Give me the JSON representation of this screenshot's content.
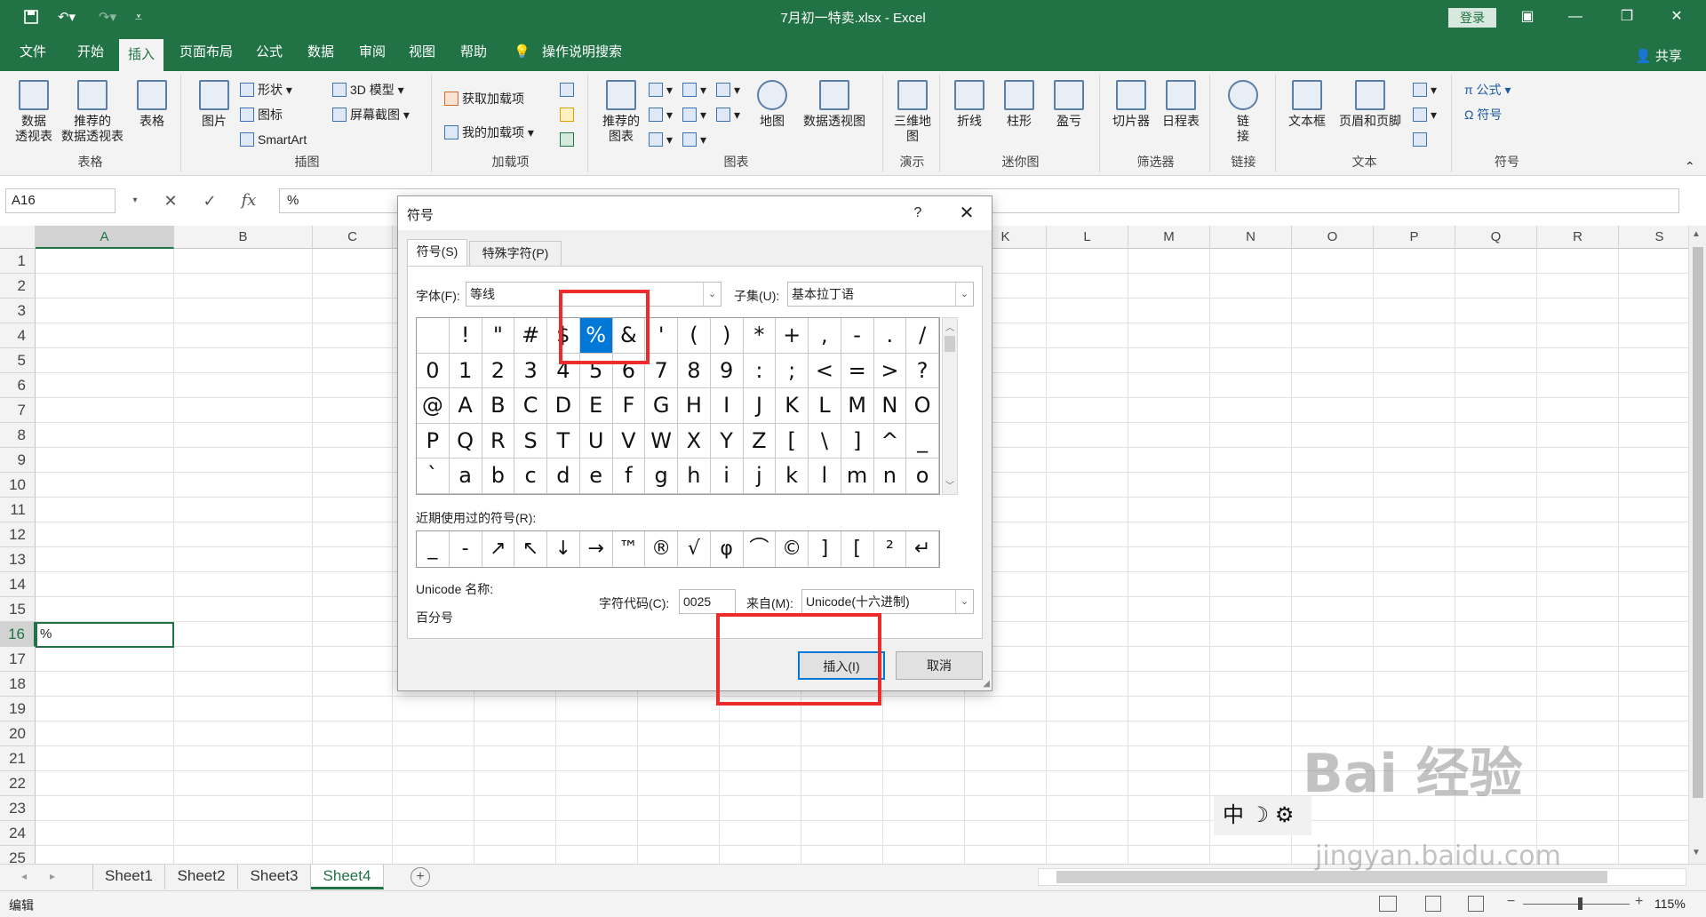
{
  "window": {
    "title": "7月初一特卖.xlsx  -  Excel",
    "login_label": "登录",
    "qa_save_icon": "save-icon",
    "qa_undo_icon": "undo-icon",
    "qa_redo_icon": "redo-icon"
  },
  "menu": {
    "tabs": [
      "文件",
      "开始",
      "插入",
      "页面布局",
      "公式",
      "数据",
      "审阅",
      "视图",
      "帮助"
    ],
    "search_label": "操作说明搜索",
    "share_label": "共享"
  },
  "ribbon": {
    "groups": {
      "tables": {
        "label": "表格",
        "pivot": "数据\n透视表",
        "recommended_pivot": "推荐的\n数据透视表",
        "table": "表格"
      },
      "illustrations": {
        "label": "插图",
        "picture": "图片",
        "shapes": "形状",
        "icons": "图标",
        "model3d": "3D 模型",
        "smartart": "SmartArt",
        "screenshot": "屏幕截图"
      },
      "addins": {
        "label": "加载项",
        "get": "获取加载项",
        "my": "我的加载项"
      },
      "charts": {
        "label": "图表",
        "recommended": "推荐的\n图表",
        "map": "地图",
        "pivotchart": "数据透视图"
      },
      "tours": {
        "label": "演示",
        "map3d": "三维地\n图"
      },
      "sparklines": {
        "label": "迷你图",
        "line": "折线",
        "column": "柱形",
        "winloss": "盈亏"
      },
      "filters": {
        "label": "筛选器",
        "slicer": "切片器",
        "timeline": "日程表"
      },
      "links": {
        "label": "链接",
        "link": "链\n接"
      },
      "text": {
        "label": "文本",
        "textbox": "文本框",
        "headerfooter": "页眉和页脚"
      },
      "symbols": {
        "label": "符号",
        "equation": "π 公式",
        "symbol": "Ω 符号"
      }
    }
  },
  "formula_bar": {
    "name_box": "A16",
    "cancel": "✕",
    "enter": "✓",
    "fx": "fx",
    "value": "%"
  },
  "grid": {
    "columns": [
      "A",
      "B",
      "C",
      "D",
      "E",
      "F",
      "G",
      "H",
      "I",
      "J",
      "K",
      "L",
      "M",
      "N",
      "O",
      "P",
      "Q",
      "R",
      "S"
    ],
    "rows": [
      "1",
      "2",
      "3",
      "4",
      "5",
      "6",
      "7",
      "8",
      "9",
      "10",
      "11",
      "12",
      "13",
      "14",
      "15",
      "16",
      "17",
      "18",
      "19",
      "20",
      "21",
      "22",
      "23",
      "24",
      "25"
    ],
    "selected_cell_value": "%"
  },
  "sheets": {
    "tabs": [
      "Sheet1",
      "Sheet2",
      "Sheet3",
      "Sheet4"
    ],
    "active": "Sheet4"
  },
  "status": {
    "mode": "编辑",
    "zoom": "115%"
  },
  "dialog": {
    "title": "符号",
    "help": "?",
    "close": "✕",
    "tab_symbols": "符号(S)",
    "tab_special": "特殊字符(P)",
    "font_label": "字体(F):",
    "font_value": "等线",
    "subset_label": "子集(U):",
    "subset_value": "基本拉丁语",
    "symbols": [
      " ",
      "!",
      "\"",
      "#",
      "$",
      "%",
      "&",
      "'",
      "(",
      ")",
      "*",
      "+",
      ",",
      "-",
      ".",
      "/",
      "0",
      "1",
      "2",
      "3",
      "4",
      "5",
      "6",
      "7",
      "8",
      "9",
      ":",
      ";",
      "<",
      "=",
      ">",
      "?",
      "@",
      "A",
      "B",
      "C",
      "D",
      "E",
      "F",
      "G",
      "H",
      "I",
      "J",
      "K",
      "L",
      "M",
      "N",
      "O",
      "P",
      "Q",
      "R",
      "S",
      "T",
      "U",
      "V",
      "W",
      "X",
      "Y",
      "Z",
      "[",
      "\\",
      "]",
      "^",
      "_",
      "`",
      "a",
      "b",
      "c",
      "d",
      "e",
      "f",
      "g",
      "h",
      "i",
      "j",
      "k",
      "l",
      "m",
      "n",
      "o"
    ],
    "selected_symbol_index": 5,
    "recent_label": "近期使用过的符号(R):",
    "recent_symbols": [
      "_",
      "-",
      "↗",
      "↖",
      "↓",
      "→",
      "™",
      "®",
      "√",
      "φ",
      "⌒",
      "©",
      "]",
      "[",
      "²",
      "↵"
    ],
    "unicode_name_label": "Unicode 名称:",
    "unicode_name_value": "百分号",
    "char_code_label": "字符代码(C):",
    "char_code_value": "0025",
    "from_label": "来自(M):",
    "from_value": "Unicode(十六进制)",
    "insert_button": "插入(I)",
    "cancel_button": "取消"
  },
  "ime": {
    "label": "中 ☽ ⚙"
  },
  "watermark": {
    "line1": "Bai 经验",
    "line2": "jingyan.baidu.com"
  },
  "colors": {
    "excel_green": "#217346",
    "selection_blue": "#0078d7",
    "highlight_red": "#ee2b2b"
  }
}
